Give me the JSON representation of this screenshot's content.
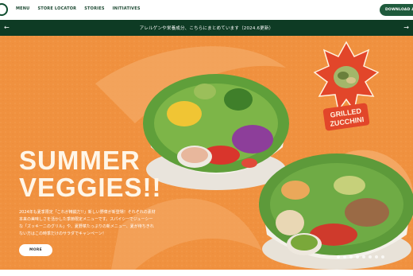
{
  "nav": {
    "links": [
      "MENU",
      "STORE LOCATOR",
      "STORIES",
      "INITIATIVES"
    ],
    "download_label": "DOWNLOAD APP"
  },
  "announcement": {
    "text": "アレルゲンや栄養成分、こちらにまとめています（2024.6更新）",
    "prev_icon": "arrow-left-icon",
    "next_icon": "arrow-right-icon"
  },
  "hero": {
    "headline_line1": "SUMMER",
    "headline_line2": "VEGGIES!!",
    "description": "2024年も夏季限定「これが精鋭だ!!」新しい野菜が新登場！それぞれの素材本来の美味しさを活かした季節限定メニューです。スパイシーでジューシーな「ズッキーニのグリル」や、夏野菜たっぷりの新メニュー、夏が待ちきれない方はこの時季だけのサラダでキャンペーン！",
    "more_label": "MORE",
    "badge_line1": "GRILLED",
    "badge_line2": "ZUCCHINI",
    "slides_total": 8,
    "slide_active": 1
  },
  "colors": {
    "brand_green": "#0e3b24",
    "hero_orange": "#f0913f",
    "badge_red": "#e2462a",
    "cream": "#fff6e8"
  }
}
